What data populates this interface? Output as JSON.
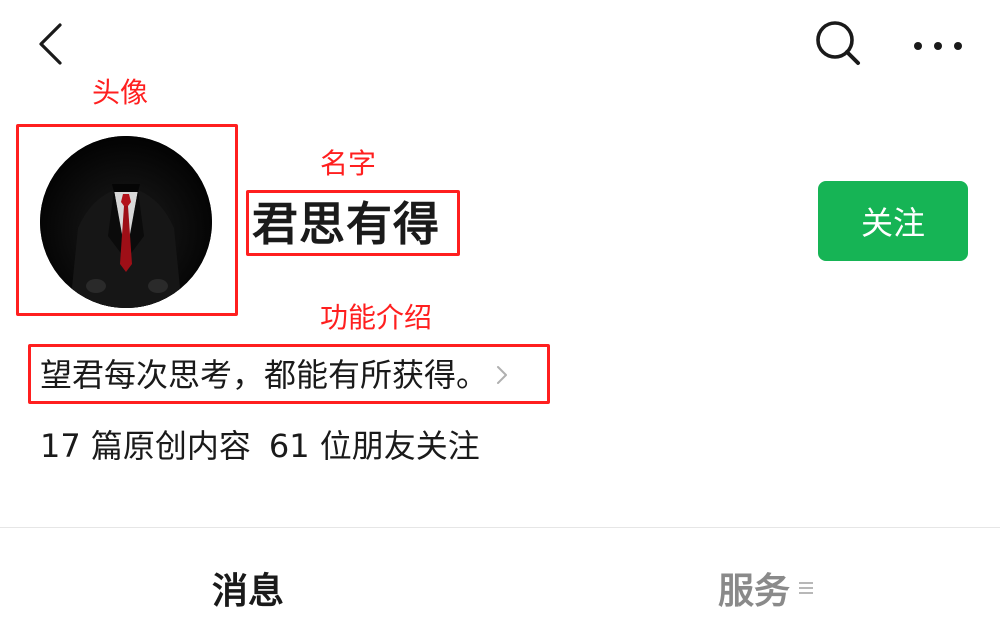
{
  "topbar": {
    "back_icon": "chevron-left-icon",
    "search_icon": "search-icon",
    "more_icon": "more-dots-icon"
  },
  "annotations": {
    "avatar_label": "头像",
    "name_label": "名字",
    "intro_label": "功能介绍",
    "color": "#ff1f1f"
  },
  "profile": {
    "name": "君思有得",
    "follow_label": "关注",
    "intro": "望君每次思考，都能有所获得。",
    "stats": {
      "articles": "17 篇原创内容",
      "followers": "61 位朋友关注"
    }
  },
  "tabs": {
    "messages": "消息",
    "services": "服务",
    "services_icon": "menu-lines-icon"
  },
  "colors": {
    "follow_button": "#16b455",
    "annotation": "#ff1f1f",
    "inactive_tab": "#8a8a8a"
  }
}
